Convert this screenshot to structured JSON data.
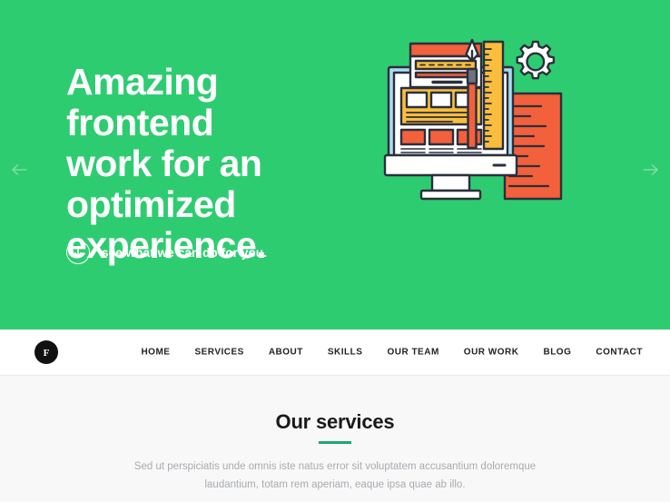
{
  "colors": {
    "hero_green": "#2ecc71",
    "accent_teal": "#19a974",
    "illus_orange": "#f2603c",
    "illus_yellow": "#fbbe3c",
    "illus_ink": "#2a2f3b",
    "illus_blue": "#aadcf0",
    "services_bg": "#f8f8f8",
    "nav_text": "#222222",
    "muted_text": "#a7abb0"
  },
  "hero": {
    "title": "Amazing frontend\nwork for an\noptimized\nexperience.",
    "cta_label": "see what we can do for you.",
    "cta_icon": "arrow-down-circle-icon",
    "prev_icon": "arrow-left-icon",
    "next_icon": "arrow-right-icon",
    "illustration_name": "web-design-monitor-pen-ruler-gear-illustration"
  },
  "navbar": {
    "logo_letter": "F",
    "logo_name": "site-logo",
    "items": [
      {
        "label": "HOME"
      },
      {
        "label": "SERVICES"
      },
      {
        "label": "ABOUT"
      },
      {
        "label": "SKILLS"
      },
      {
        "label": "OUR TEAM"
      },
      {
        "label": "OUR WORK"
      },
      {
        "label": "BLOG"
      },
      {
        "label": "CONTACT"
      }
    ]
  },
  "services": {
    "title": "Our services",
    "subtitle": "Sed ut perspiciatis unde omnis iste natus error sit voluptatem accusantium doloremque\nlaudantium, totam rem aperiam, eaque ipsa quae ab illo."
  }
}
